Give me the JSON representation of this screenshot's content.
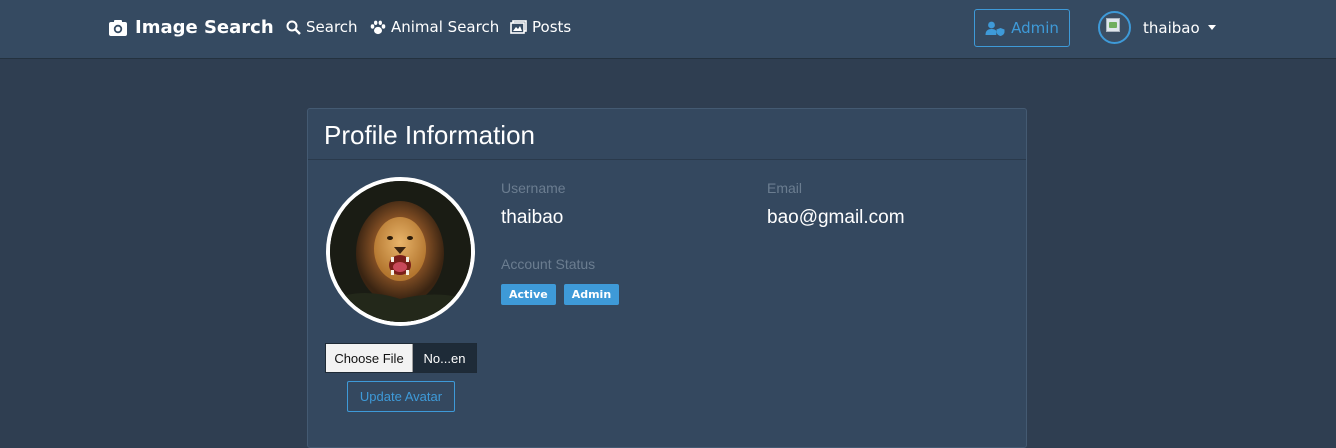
{
  "navbar": {
    "brand": "Image Search",
    "links": [
      {
        "label": "Search",
        "icon": "search-icon"
      },
      {
        "label": "Animal Search",
        "icon": "paw-icon"
      },
      {
        "label": "Posts",
        "icon": "images-icon"
      }
    ],
    "admin_button": "Admin",
    "username": "thaibao"
  },
  "profile": {
    "title": "Profile Information",
    "username_label": "Username",
    "username": "thaibao",
    "email_label": "Email",
    "email": "bao@gmail.com",
    "status_label": "Account Status",
    "badges": [
      "Active",
      "Admin"
    ],
    "file_choose": "Choose File",
    "file_name": "No...en",
    "update_button": "Update Avatar"
  },
  "colors": {
    "accent": "#3e9ad8",
    "navbar_bg": "#354a61",
    "page_bg": "#2f3e51",
    "card_bg": "#34485f"
  }
}
